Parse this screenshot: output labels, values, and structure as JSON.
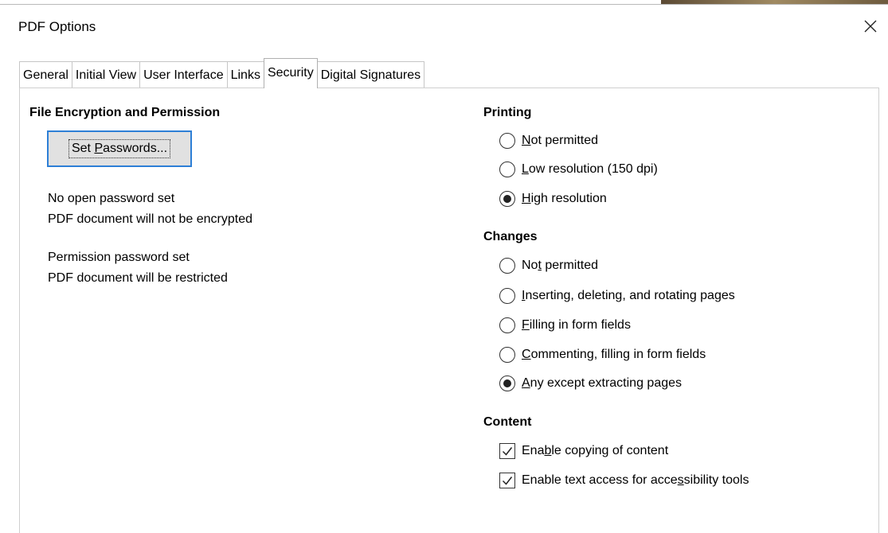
{
  "window": {
    "title": "PDF Options",
    "close_icon": "close-icon"
  },
  "tabs": [
    {
      "label": "General",
      "active": false
    },
    {
      "label": "Initial View",
      "active": false
    },
    {
      "label": "User Interface",
      "active": false
    },
    {
      "label": "Links",
      "active": false
    },
    {
      "label": "Security",
      "active": true
    },
    {
      "label": "Digital Signatures",
      "active": false
    }
  ],
  "encryption": {
    "title": "File Encryption and Permission",
    "set_passwords_button": {
      "pre": "Set ",
      "key": "P",
      "post": "asswords..."
    },
    "open_password_status": "No open password set",
    "encryption_status": "PDF document will not be encrypted",
    "permission_password_status": "Permission password set",
    "restriction_status": "PDF document will be restricted"
  },
  "printing": {
    "title": "Printing",
    "options": [
      {
        "pre": "",
        "key": "N",
        "post": "ot permitted",
        "selected": false
      },
      {
        "pre": "",
        "key": "L",
        "post": "ow resolution (150 dpi)",
        "selected": false
      },
      {
        "pre": "",
        "key": "H",
        "post": "igh resolution",
        "selected": true
      }
    ]
  },
  "changes": {
    "title": "Changes",
    "options": [
      {
        "pre": "No",
        "key": "t",
        "post": " permitted",
        "selected": false
      },
      {
        "pre": "",
        "key": "I",
        "post": "nserting, deleting, and rotating pages",
        "selected": false
      },
      {
        "pre": "",
        "key": "F",
        "post": "illing in form fields",
        "selected": false
      },
      {
        "pre": "",
        "key": "C",
        "post": "ommenting, filling in form fields",
        "selected": false
      },
      {
        "pre": "",
        "key": "A",
        "post": "ny except extracting pages",
        "selected": true
      }
    ]
  },
  "content": {
    "title": "Content",
    "options": [
      {
        "pre": "Ena",
        "key": "b",
        "post": "le copying of content",
        "checked": true
      },
      {
        "pre": "Enable text access for acce",
        "key": "s",
        "post": "sibility tools",
        "checked": true
      }
    ]
  },
  "colors": {
    "focus_border": "#2d7fd6",
    "button_bg": "#e1e1e1"
  }
}
